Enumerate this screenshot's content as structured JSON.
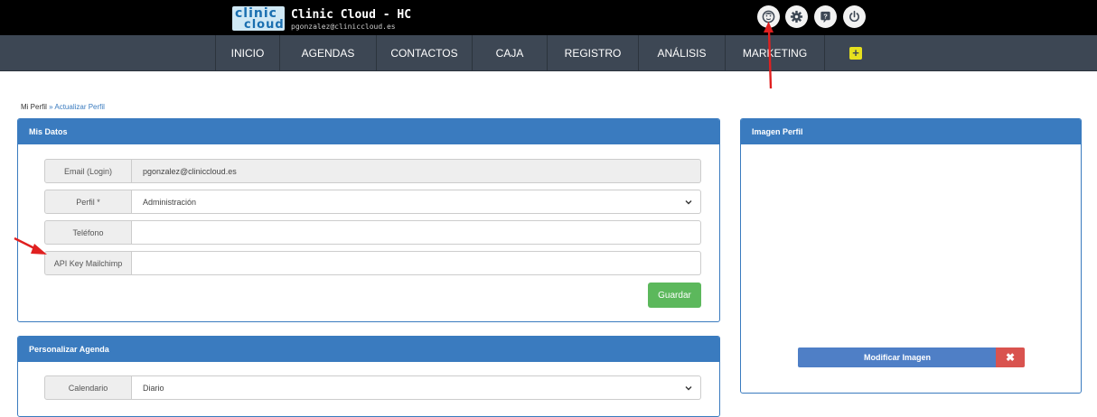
{
  "brand": {
    "logo_top": "clinic",
    "logo_bottom": "cloud",
    "title": "Clinic Cloud - HC",
    "email": "pgonzalez@cliniccloud.es"
  },
  "top_icons": [
    "profile-icon",
    "settings-icon",
    "help-icon",
    "power-icon"
  ],
  "nav": {
    "items": [
      "INICIO",
      "AGENDAS",
      "CONTACTOS",
      "CAJA",
      "REGISTRO",
      "ANÁLISIS",
      "MARKETING"
    ],
    "plus": "+"
  },
  "breadcrumb": {
    "root": "Mi Perfil",
    "sep": "»",
    "current": "Actualizar Perfil"
  },
  "mis_datos": {
    "title": "Mis Datos",
    "email_label": "Email (Login)",
    "email_value": "pgonzalez@cliniccloud.es",
    "perfil_label": "Perfil *",
    "perfil_value": "Administración",
    "telefono_label": "Teléfono",
    "telefono_value": "",
    "api_label": "API Key Mailchimp",
    "api_value": "",
    "save_label": "Guardar"
  },
  "imagen_perfil": {
    "title": "Imagen Perfil",
    "modify_label": "Modificar Imagen",
    "remove_label": "✖"
  },
  "personalizar_agenda": {
    "title": "Personalizar Agenda",
    "calendario_label": "Calendario",
    "calendario_value": "Diario"
  },
  "colors": {
    "panel_blue": "#3a7bbf",
    "nav_bg": "#3d4754",
    "save_green": "#5cb85c",
    "remove_red": "#d9534f",
    "annotation_red": "#e02020"
  }
}
